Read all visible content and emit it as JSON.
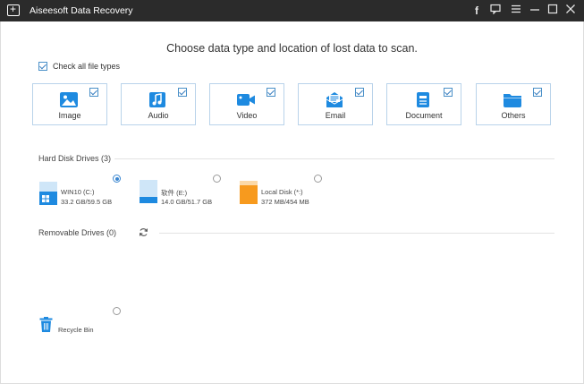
{
  "window": {
    "title": "Aiseesoft Data Recovery",
    "controls": [
      "facebook-icon",
      "feedback-icon",
      "menu-icon",
      "minimize-icon",
      "maximize-icon",
      "close-icon"
    ]
  },
  "main": {
    "heading": "Choose data type and location of lost data to scan.",
    "check_all": {
      "label": "Check all file types",
      "checked": true
    }
  },
  "file_types": [
    {
      "label": "Image",
      "icon": "image-icon",
      "checked": true
    },
    {
      "label": "Audio",
      "icon": "audio-icon",
      "checked": true
    },
    {
      "label": "Video",
      "icon": "video-icon",
      "checked": true
    },
    {
      "label": "Email",
      "icon": "email-icon",
      "checked": true
    },
    {
      "label": "Document",
      "icon": "document-icon",
      "checked": true
    },
    {
      "label": "Others",
      "icon": "folder-icon",
      "checked": true
    }
  ],
  "hard_disk": {
    "title": "Hard Disk Drives (3)",
    "drives": [
      {
        "name": "WIN10 (C:)",
        "size": "33.2 GB/59.5 GB",
        "used_fraction": 0.56,
        "selected": true,
        "color": "#1e8ae0"
      },
      {
        "name": "软件 (E:)",
        "size": "14.0 GB/51.7 GB",
        "used_fraction": 0.27,
        "selected": false,
        "color": "#1e8ae0"
      },
      {
        "name": "Local Disk (*:)",
        "size": "372 MB/454 MB",
        "used_fraction": 0.82,
        "selected": false,
        "color": "#f79a1e"
      }
    ]
  },
  "removable": {
    "title": "Removable Drives (0)",
    "refresh_icon": "refresh-icon"
  },
  "recycle_bin": {
    "label": "Recycle Bin",
    "icon": "trash-icon",
    "selected": false
  },
  "colors": {
    "accent": "#1e8ae0",
    "titlebar": "#2b2b2b",
    "card_border": "#b9d3ea"
  }
}
